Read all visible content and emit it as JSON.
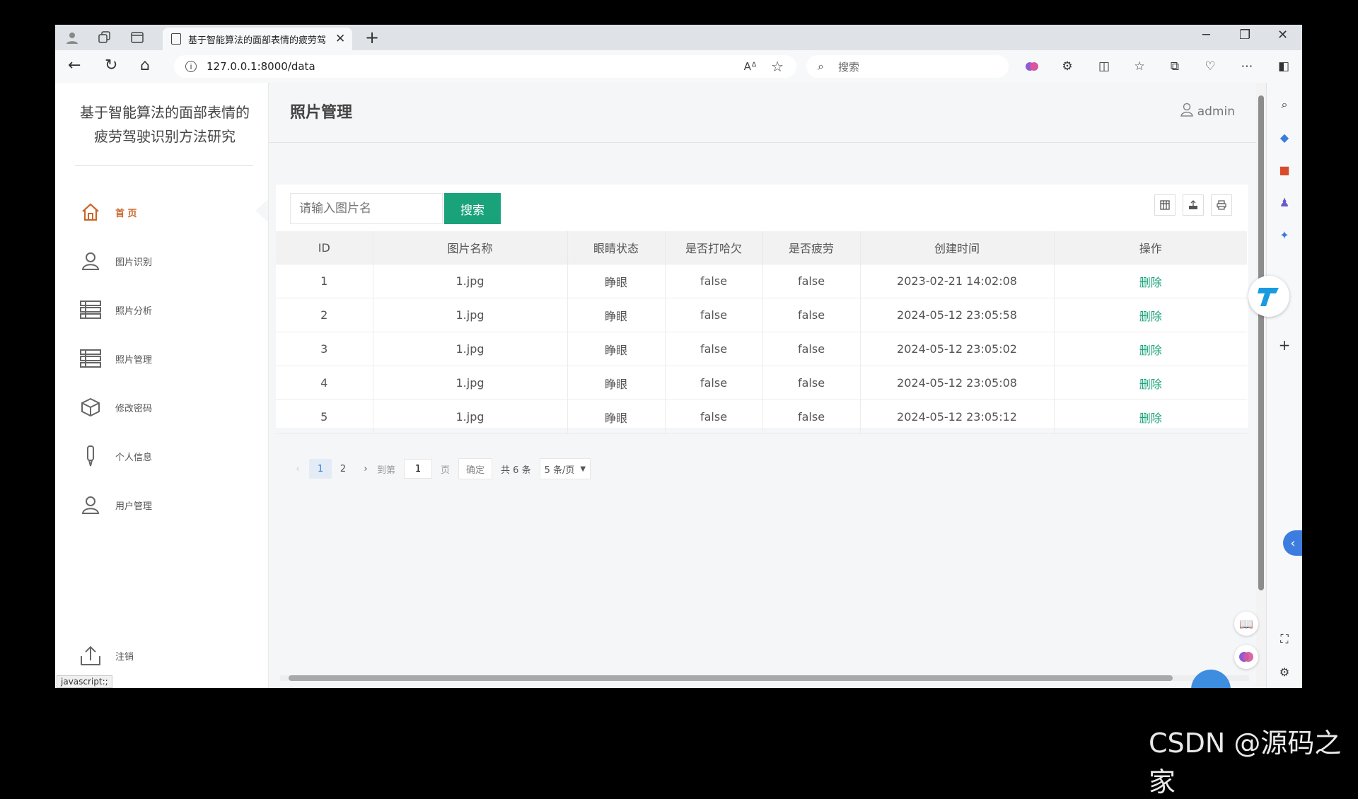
{
  "browser": {
    "tab_title": "基于智能算法的面部表情的疲劳驾",
    "address": "127.0.0.1:8000/data",
    "search_placeholder": "搜索",
    "status_url": "javascript:;"
  },
  "sidebar": {
    "brand_line1": "基于智能算法的面部表情的",
    "brand_line2": "疲劳驾驶识别方法研究",
    "items": [
      {
        "label": "首 页",
        "icon": "home-icon"
      },
      {
        "label": "图片识别",
        "icon": "user-icon"
      },
      {
        "label": "照片分析",
        "icon": "list-icon"
      },
      {
        "label": "照片管理",
        "icon": "list-icon"
      },
      {
        "label": "修改密码",
        "icon": "cube-icon"
      },
      {
        "label": "个人信息",
        "icon": "pen-icon"
      },
      {
        "label": "用户管理",
        "icon": "user-icon"
      }
    ],
    "logout_label": "注销"
  },
  "header": {
    "title": "照片管理",
    "user": "admin"
  },
  "search": {
    "placeholder": "请输入图片名",
    "button": "搜索"
  },
  "table": {
    "columns": [
      "ID",
      "图片名称",
      "眼睛状态",
      "是否打哈欠",
      "是否疲劳",
      "创建时间",
      "操作"
    ],
    "rows": [
      [
        "1",
        "1.jpg",
        "睁眼",
        "false",
        "false",
        "2023-02-21 14:02:08",
        "删除"
      ],
      [
        "2",
        "1.jpg",
        "睁眼",
        "false",
        "false",
        "2024-05-12 23:05:58",
        "删除"
      ],
      [
        "3",
        "1.jpg",
        "睁眼",
        "false",
        "false",
        "2024-05-12 23:05:02",
        "删除"
      ],
      [
        "4",
        "1.jpg",
        "睁眼",
        "false",
        "false",
        "2024-05-12 23:05:08",
        "删除"
      ],
      [
        "5",
        "1.jpg",
        "睁眼",
        "false",
        "false",
        "2024-05-12 23:05:12",
        "删除"
      ]
    ]
  },
  "pagination": {
    "prev": "‹",
    "page1": "1",
    "page2": "2",
    "next": "›",
    "goto_label": "到第",
    "goto_value": "1",
    "page_unit": "页",
    "confirm": "确定",
    "total": "共 6 条",
    "page_size": "5 条/页"
  },
  "watermark": "CSDN @源码之家",
  "colors": {
    "accent": "#1aa37a",
    "active_menu": "#c9662a"
  }
}
